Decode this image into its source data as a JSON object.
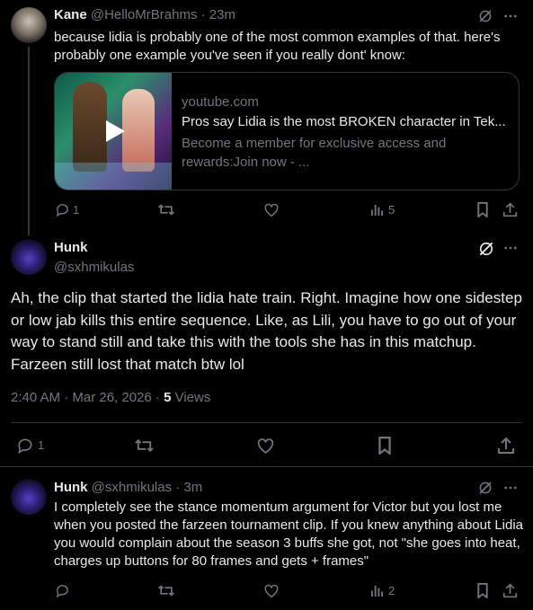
{
  "tweet1": {
    "name": "Kane",
    "handle": "@HelloMrBrahms",
    "time": "· 23m",
    "text": "because lidia is probably one of the most common examples of that. here's probably one example you've seen if you really dont' know:",
    "card": {
      "domain": "youtube.com",
      "title": "Pros say Lidia is the most BROKEN character in Tek...",
      "desc": "Become a member for exclusive access and rewards:Join now - ..."
    },
    "replies": "1",
    "views": "5"
  },
  "main": {
    "name": "Hunk",
    "handle": "@sxhmikulas",
    "text": "Ah, the clip that started the lidia hate train. Right. Imagine how one sidestep or low jab kills this entire sequence. Like, as Lili, you have to go out of your way to stand still and take this with the tools she has in this matchup. Farzeen still lost that match btw lol",
    "timestamp": "2:40 AM · Mar 26, 2026 · ",
    "views_count": "5",
    "views_label": " Views",
    "replies": "1"
  },
  "tweet3": {
    "name": "Hunk",
    "handle": "@sxhmikulas",
    "time": "· 3m",
    "text": "I completely see the stance momentum argument for Victor but you lost me when you posted the farzeen tournament clip. If you knew anything about Lidia you would complain about the season 3 buffs she got, not \"she goes into heat, charges up buttons for 80 frames and gets + frames\"",
    "views": "2"
  },
  "colors": {
    "bg": "#000000",
    "text": "#e7e9ea",
    "muted": "#71767b",
    "border": "#2f3336",
    "play": "#ffffff"
  },
  "icons": [
    "grok-icon",
    "more-icon",
    "reply-icon",
    "retweet-icon",
    "like-icon",
    "views-icon",
    "bookmark-icon",
    "share-icon",
    "play-icon"
  ]
}
